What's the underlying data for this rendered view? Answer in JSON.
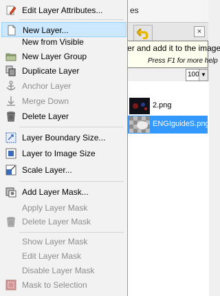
{
  "background": {
    "dock_title_fragment": "es",
    "tooltip": {
      "text": "Create a new layer and add it to the image",
      "help": "Press F1 for more help"
    },
    "mode_value": "100.0",
    "layers": [
      {
        "name": "2.png",
        "selected": false
      },
      {
        "name": "ENGIguideS.png",
        "selected": true
      }
    ]
  },
  "menu": {
    "items": [
      {
        "label": "Edit Layer Attributes...",
        "icon": "edit-attributes-icon",
        "enabled": true
      },
      {
        "label": "New Layer...",
        "icon": "new-layer-icon",
        "enabled": true,
        "highlighted": true
      },
      {
        "label": "New from Visible",
        "icon": "",
        "enabled": true
      },
      {
        "label": "New Layer Group",
        "icon": "folder-icon",
        "enabled": true
      },
      {
        "label": "Duplicate Layer",
        "icon": "duplicate-icon",
        "enabled": true
      },
      {
        "label": "Anchor Layer",
        "icon": "anchor-icon",
        "enabled": false
      },
      {
        "label": "Merge Down",
        "icon": "merge-down-icon",
        "enabled": false
      },
      {
        "label": "Delete Layer",
        "icon": "delete-icon",
        "enabled": true
      },
      {
        "label": "Layer Boundary Size...",
        "icon": "boundary-size-icon",
        "enabled": true
      },
      {
        "label": "Layer to Image Size",
        "icon": "layer-to-image-size-icon",
        "enabled": true
      },
      {
        "label": "Scale Layer...",
        "icon": "scale-layer-icon",
        "enabled": true
      },
      {
        "label": "Add Layer Mask...",
        "icon": "add-mask-icon",
        "enabled": true
      },
      {
        "label": "Apply Layer Mask",
        "icon": "",
        "enabled": false
      },
      {
        "label": "Delete Layer Mask",
        "icon": "delete-mask-icon",
        "enabled": false
      },
      {
        "label": "Show Layer Mask",
        "icon": "",
        "enabled": false
      },
      {
        "label": "Edit Layer Mask",
        "icon": "",
        "enabled": false
      },
      {
        "label": "Disable Layer Mask",
        "icon": "",
        "enabled": false
      },
      {
        "label": "Mask to Selection",
        "icon": "mask-to-selection-icon",
        "enabled": false
      }
    ]
  },
  "colors": {
    "menu_bg": "#f2f2f2",
    "highlight_bg": "#cce8ff",
    "highlight_border": "#99d1ff",
    "selected_layer": "#3399ff",
    "tooltip_bg": "#fffff0",
    "disabled_text": "#8d8d8d"
  }
}
